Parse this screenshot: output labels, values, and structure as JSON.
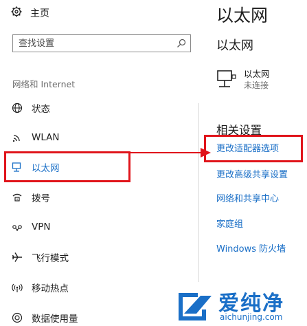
{
  "sidebar": {
    "home_label": "主页",
    "search_placeholder": "查找设置",
    "section_title": "网络和 Internet",
    "items": [
      {
        "label": "状态",
        "icon": "status-globe-icon"
      },
      {
        "label": "WLAN",
        "icon": "wifi-icon"
      },
      {
        "label": "以太网",
        "icon": "ethernet-icon",
        "active": true
      },
      {
        "label": "拨号",
        "icon": "dialup-icon"
      },
      {
        "label": "VPN",
        "icon": "vpn-icon"
      },
      {
        "label": "飞行模式",
        "icon": "airplane-icon"
      },
      {
        "label": "移动热点",
        "icon": "hotspot-icon"
      },
      {
        "label": "数据使用量",
        "icon": "data-usage-icon"
      }
    ]
  },
  "main": {
    "title": "以太网",
    "subtitle": "以太网",
    "adapter": {
      "name": "以太网",
      "status": "未连接"
    },
    "related_title": "相关设置",
    "links": [
      "更改适配器选项",
      "更改高级共享设置",
      "网络和共享中心",
      "家庭组",
      "Windows 防火墙"
    ]
  },
  "watermark": {
    "text_cn": "爱纯净",
    "text_en": "aichunjing.com"
  },
  "colors": {
    "accent": "#1a6fc7",
    "highlight": "#e0141b",
    "text": "#1f1f1f",
    "muted": "#6d6d6d"
  }
}
